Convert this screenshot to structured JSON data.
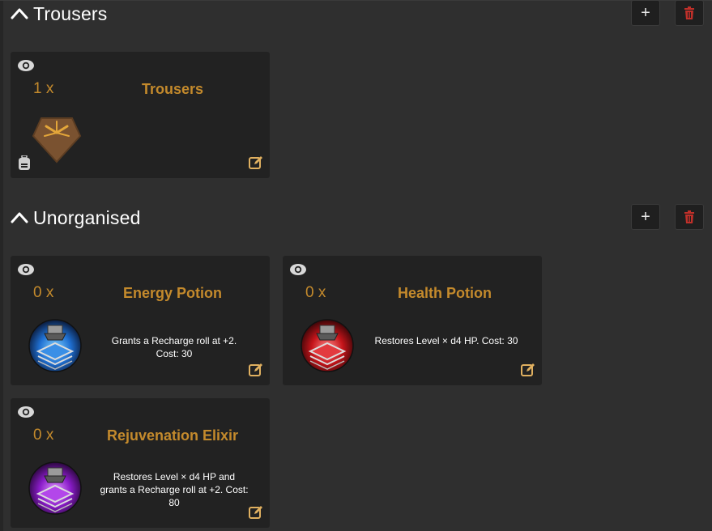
{
  "groups": [
    {
      "title": "Trousers",
      "add_label": "+",
      "delete_icon": "trash-icon",
      "items": [
        {
          "quantity": "1 x",
          "name": "Trousers",
          "description": "",
          "icon": "trousers-icon"
        }
      ]
    },
    {
      "title": "Unorganised",
      "add_label": "+",
      "delete_icon": "trash-icon",
      "items": [
        {
          "quantity": "0 x",
          "name": "Energy Potion",
          "description": "Grants a Recharge roll at +2. Cost: 30",
          "icon": "blue-potion-icon"
        },
        {
          "quantity": "0 x",
          "name": "Health Potion",
          "description": "Restores Level × d4 HP. Cost: 30",
          "icon": "red-potion-icon"
        },
        {
          "quantity": "0 x",
          "name": "Rejuvenation Elixir",
          "description": "Restores Level × d4 HP and grants a Recharge roll at +2. Cost: 80",
          "icon": "purple-potion-icon"
        }
      ]
    }
  ],
  "colors": {
    "background": "#2f2f2f",
    "card": "#222222",
    "accent_text": "#c48a2c",
    "edit_icon": "#e0b060",
    "delete_icon": "#c0302a"
  }
}
